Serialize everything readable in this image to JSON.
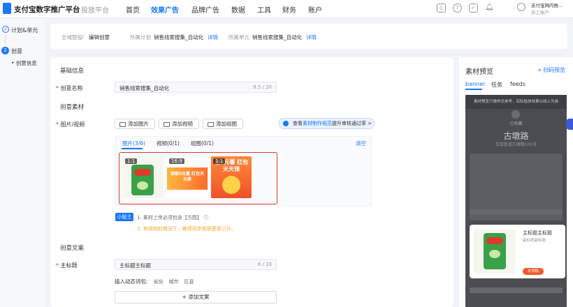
{
  "header": {
    "brand": "支付宝数字推广平台",
    "platform": "投放平台",
    "nav": [
      {
        "label": "首页",
        "active": false
      },
      {
        "label": "效果广告",
        "active": true
      },
      {
        "label": "品牌广告",
        "active": false
      },
      {
        "label": "数据",
        "active": false
      },
      {
        "label": "工具",
        "active": false
      },
      {
        "label": "财务",
        "active": false
      },
      {
        "label": "账户",
        "active": false
      }
    ],
    "icons": [
      "phone-icon",
      "help-icon",
      "task-icon",
      "bell-icon"
    ],
    "account_name": "支付宝网内推...",
    "account_role": "员工账户"
  },
  "sidebar": {
    "steps": [
      {
        "index": "✓",
        "label": "计划&单元"
      },
      {
        "index": "2",
        "label": "创意"
      }
    ],
    "substep": "创意信息"
  },
  "breadcrumb": {
    "items": [
      "全域智投",
      "编辑创意"
    ],
    "plan_label": "所属计划",
    "plan_value": "销售线索搜集_自动化",
    "unit_label": "所属单元",
    "unit_value": "销售线索搜集_自动化",
    "detail_link": "详情"
  },
  "form": {
    "basic_section": "基础信息",
    "name_label": "创意名称",
    "name_value": "销售线索搜集_自动化",
    "name_count": "9.5 / 20",
    "material_section": "创意素材",
    "media_label": "图片/视频",
    "add_image": "添加图片",
    "add_video": "添加视频",
    "add_group": "添加组图",
    "promo_text": "查看",
    "promo_link": "素材制作规范",
    "promo_tail": "提升审核通过率 >",
    "media_tabs": [
      "图片(3/6)",
      "视频(0/1)",
      "组图(0/1)"
    ],
    "clear": "清空",
    "thumbs": [
      {
        "ratio": "1:1"
      },
      {
        "ratio": "16:9",
        "text": "领取0元薯 红包天天拿"
      },
      {
        "ratio": "1:1",
        "text": "领0元薯 红包天天领"
      }
    ],
    "tip_tag": "小贴士",
    "tip1": "1. 素材上传必须包含【方图】 ⓘ",
    "tip2": "2. 有视频的情况下，推荐同步投放更高上升。",
    "copy_section": "创意文案",
    "main_title_label": "主标题",
    "main_title_value": "主标题主标题",
    "main_title_count": "6 / 10",
    "dynamic_label": "插入动态词包:",
    "dynamic_words": [
      "省份",
      "城市",
      "区县"
    ],
    "add_copy": "+ 添加文案"
  },
  "preview": {
    "title": "素材预览",
    "scan": "扫码预览",
    "tabs": [
      "banner",
      "任务",
      "feeds"
    ],
    "notice": "素材预览只做样式参考，实际投放效果以线上为准",
    "shop_tag": "已收藏",
    "store_name": "古墩路",
    "store_addr": "车库街道古墩路101号",
    "banner_title": "主标题主标题",
    "banner_sub": "副标题副标题",
    "banner_button": "去领取"
  }
}
